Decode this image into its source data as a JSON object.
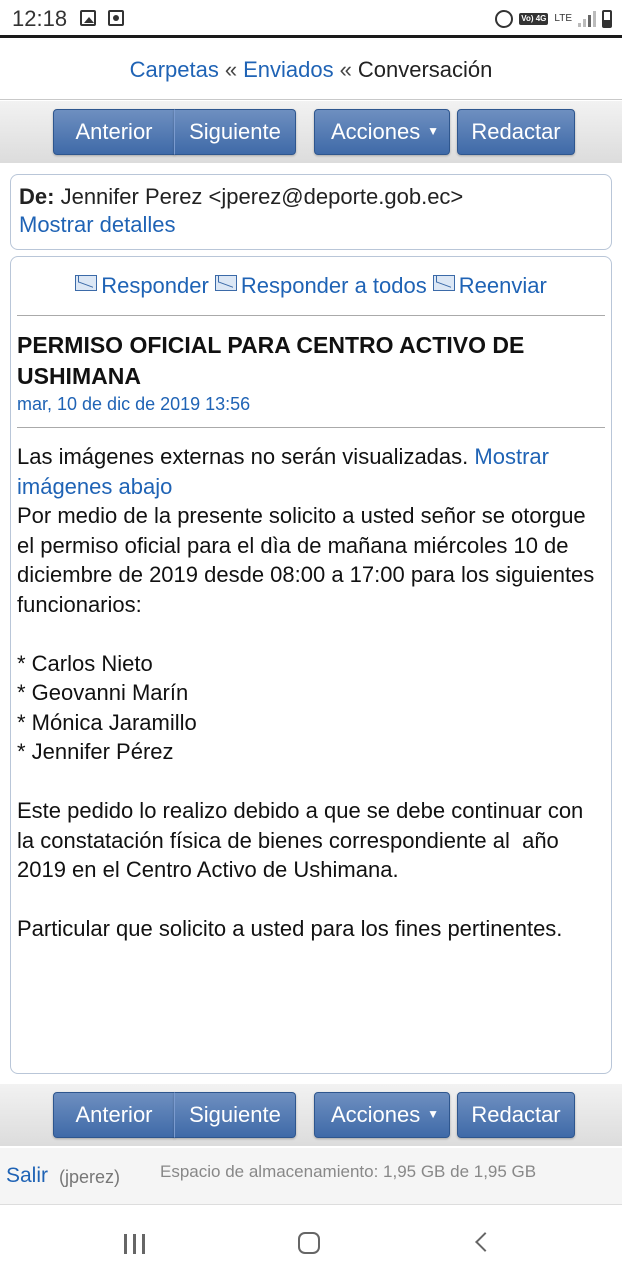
{
  "status_bar": {
    "time": "12:18",
    "volte": "Vo) 4G",
    "network": "LTE",
    "colors": {
      "text": "#333333"
    }
  },
  "breadcrumb": {
    "folders": "Carpetas",
    "sep1": "«",
    "sent": "Enviados",
    "sep2": "«",
    "current": "Conversación"
  },
  "toolbar": {
    "previous": "Anterior",
    "next": "Siguiente",
    "actions": "Acciones",
    "compose": "Redactar"
  },
  "message": {
    "from_label": "De:",
    "from_value": "Jennifer Perez <jperez@deporte.gob.ec>",
    "show_details": "Mostrar detalles",
    "reply": "Responder",
    "reply_all": "Responder a todos",
    "forward": "Reenviar",
    "subject": "PERMISO OFICIAL PARA CENTRO ACTIVO DE USHIMANA",
    "date": "mar, 10 de dic de 2019 13:56",
    "images_notice": "Las imágenes externas no serán visualizadas.",
    "show_images": "Mostrar imágenes abajo",
    "body_intro": "Por medio de la presente solicito a usted señor se otorgue el permiso oficial para el dìa de mañana miércoles 10 de diciembre de 2019 desde 08:00 a 17:00 para los siguientes funcionarios:",
    "people": [
      "* Carlos Nieto",
      "* Geovanni Marín",
      "* Mónica Jaramillo",
      "* Jennifer Pérez"
    ],
    "body_reason": "Este pedido lo realizo debido a que se debe continuar con la constatación física de bienes correspondiente al  año 2019 en el Centro Activo de Ushimana.",
    "body_closing": "Particular que solicito a usted para los fines pertinentes."
  },
  "footer": {
    "logout": "Salir",
    "user": "(jperez)",
    "storage": "Espacio de almacenamiento: 1,95 GB de 1,95 GB"
  },
  "colors": {
    "link": "#1f63b5",
    "button": "#4a72b0"
  }
}
